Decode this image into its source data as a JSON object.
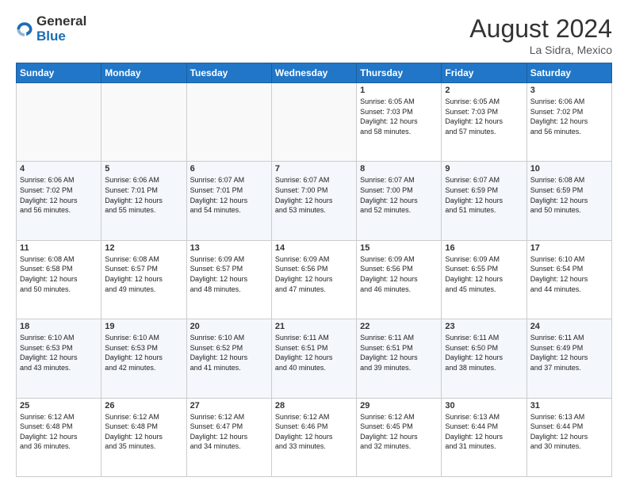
{
  "logo": {
    "text_general": "General",
    "text_blue": "Blue"
  },
  "header": {
    "month_year": "August 2024",
    "location": "La Sidra, Mexico"
  },
  "days_of_week": [
    "Sunday",
    "Monday",
    "Tuesday",
    "Wednesday",
    "Thursday",
    "Friday",
    "Saturday"
  ],
  "weeks": [
    [
      {
        "day": "",
        "info": ""
      },
      {
        "day": "",
        "info": ""
      },
      {
        "day": "",
        "info": ""
      },
      {
        "day": "",
        "info": ""
      },
      {
        "day": "1",
        "info": "Sunrise: 6:05 AM\nSunset: 7:03 PM\nDaylight: 12 hours\nand 58 minutes."
      },
      {
        "day": "2",
        "info": "Sunrise: 6:05 AM\nSunset: 7:03 PM\nDaylight: 12 hours\nand 57 minutes."
      },
      {
        "day": "3",
        "info": "Sunrise: 6:06 AM\nSunset: 7:02 PM\nDaylight: 12 hours\nand 56 minutes."
      }
    ],
    [
      {
        "day": "4",
        "info": "Sunrise: 6:06 AM\nSunset: 7:02 PM\nDaylight: 12 hours\nand 56 minutes."
      },
      {
        "day": "5",
        "info": "Sunrise: 6:06 AM\nSunset: 7:01 PM\nDaylight: 12 hours\nand 55 minutes."
      },
      {
        "day": "6",
        "info": "Sunrise: 6:07 AM\nSunset: 7:01 PM\nDaylight: 12 hours\nand 54 minutes."
      },
      {
        "day": "7",
        "info": "Sunrise: 6:07 AM\nSunset: 7:00 PM\nDaylight: 12 hours\nand 53 minutes."
      },
      {
        "day": "8",
        "info": "Sunrise: 6:07 AM\nSunset: 7:00 PM\nDaylight: 12 hours\nand 52 minutes."
      },
      {
        "day": "9",
        "info": "Sunrise: 6:07 AM\nSunset: 6:59 PM\nDaylight: 12 hours\nand 51 minutes."
      },
      {
        "day": "10",
        "info": "Sunrise: 6:08 AM\nSunset: 6:59 PM\nDaylight: 12 hours\nand 50 minutes."
      }
    ],
    [
      {
        "day": "11",
        "info": "Sunrise: 6:08 AM\nSunset: 6:58 PM\nDaylight: 12 hours\nand 50 minutes."
      },
      {
        "day": "12",
        "info": "Sunrise: 6:08 AM\nSunset: 6:57 PM\nDaylight: 12 hours\nand 49 minutes."
      },
      {
        "day": "13",
        "info": "Sunrise: 6:09 AM\nSunset: 6:57 PM\nDaylight: 12 hours\nand 48 minutes."
      },
      {
        "day": "14",
        "info": "Sunrise: 6:09 AM\nSunset: 6:56 PM\nDaylight: 12 hours\nand 47 minutes."
      },
      {
        "day": "15",
        "info": "Sunrise: 6:09 AM\nSunset: 6:56 PM\nDaylight: 12 hours\nand 46 minutes."
      },
      {
        "day": "16",
        "info": "Sunrise: 6:09 AM\nSunset: 6:55 PM\nDaylight: 12 hours\nand 45 minutes."
      },
      {
        "day": "17",
        "info": "Sunrise: 6:10 AM\nSunset: 6:54 PM\nDaylight: 12 hours\nand 44 minutes."
      }
    ],
    [
      {
        "day": "18",
        "info": "Sunrise: 6:10 AM\nSunset: 6:53 PM\nDaylight: 12 hours\nand 43 minutes."
      },
      {
        "day": "19",
        "info": "Sunrise: 6:10 AM\nSunset: 6:53 PM\nDaylight: 12 hours\nand 42 minutes."
      },
      {
        "day": "20",
        "info": "Sunrise: 6:10 AM\nSunset: 6:52 PM\nDaylight: 12 hours\nand 41 minutes."
      },
      {
        "day": "21",
        "info": "Sunrise: 6:11 AM\nSunset: 6:51 PM\nDaylight: 12 hours\nand 40 minutes."
      },
      {
        "day": "22",
        "info": "Sunrise: 6:11 AM\nSunset: 6:51 PM\nDaylight: 12 hours\nand 39 minutes."
      },
      {
        "day": "23",
        "info": "Sunrise: 6:11 AM\nSunset: 6:50 PM\nDaylight: 12 hours\nand 38 minutes."
      },
      {
        "day": "24",
        "info": "Sunrise: 6:11 AM\nSunset: 6:49 PM\nDaylight: 12 hours\nand 37 minutes."
      }
    ],
    [
      {
        "day": "25",
        "info": "Sunrise: 6:12 AM\nSunset: 6:48 PM\nDaylight: 12 hours\nand 36 minutes."
      },
      {
        "day": "26",
        "info": "Sunrise: 6:12 AM\nSunset: 6:48 PM\nDaylight: 12 hours\nand 35 minutes."
      },
      {
        "day": "27",
        "info": "Sunrise: 6:12 AM\nSunset: 6:47 PM\nDaylight: 12 hours\nand 34 minutes."
      },
      {
        "day": "28",
        "info": "Sunrise: 6:12 AM\nSunset: 6:46 PM\nDaylight: 12 hours\nand 33 minutes."
      },
      {
        "day": "29",
        "info": "Sunrise: 6:12 AM\nSunset: 6:45 PM\nDaylight: 12 hours\nand 32 minutes."
      },
      {
        "day": "30",
        "info": "Sunrise: 6:13 AM\nSunset: 6:44 PM\nDaylight: 12 hours\nand 31 minutes."
      },
      {
        "day": "31",
        "info": "Sunrise: 6:13 AM\nSunset: 6:44 PM\nDaylight: 12 hours\nand 30 minutes."
      }
    ]
  ]
}
